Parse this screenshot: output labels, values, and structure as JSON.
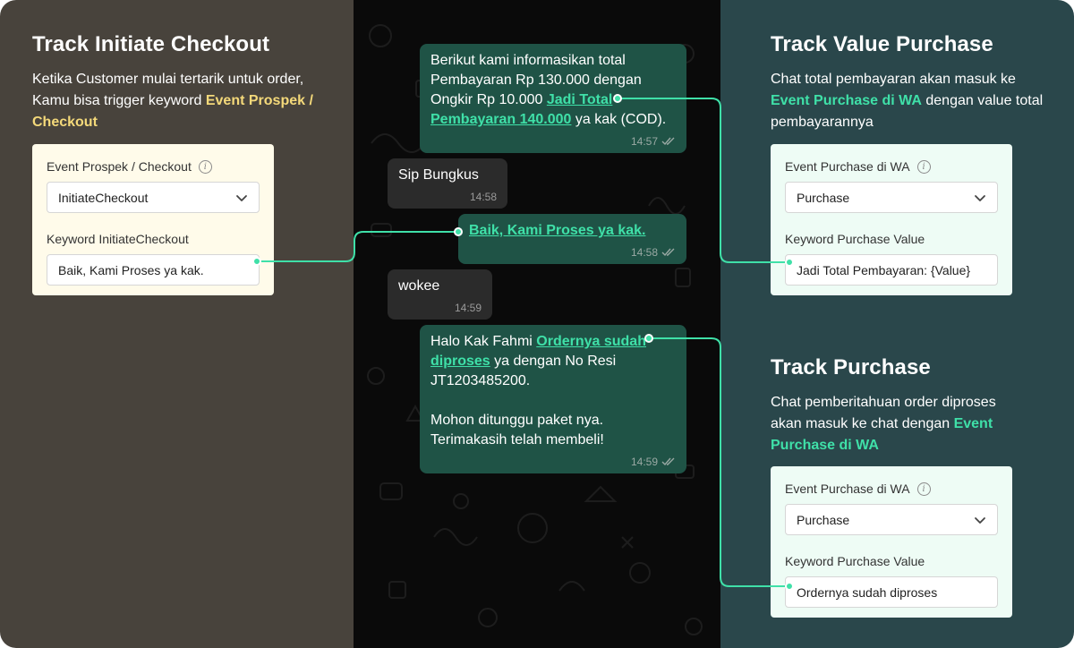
{
  "left": {
    "heading": "Track Initiate Checkout",
    "desc_1": "Ketika Customer mulai tertarik  untuk order, Kamu bisa trigger keyword ",
    "desc_hl": "Event Prospek / Checkout",
    "card": {
      "event_label": "Event Prospek / Checkout",
      "event_value": "InitiateCheckout",
      "keyword_label": "Keyword InitiateCheckout",
      "keyword_value": "Baik, Kami Proses ya kak."
    }
  },
  "chat": {
    "msg1": {
      "text_1": "Berikut kami informasikan total Pembayaran Rp 130.000 dengan Ongkir Rp 10.000 ",
      "link": "Jadi Total Pembayaran 140.000",
      "text_2": "  ya kak (COD).",
      "time": "14:57"
    },
    "msg2": {
      "text": "Sip Bungkus",
      "time": "14:58"
    },
    "msg3": {
      "link": "Baik, Kami Proses ya kak.",
      "time": "14:58"
    },
    "msg4": {
      "text": "wokee",
      "time": "14:59"
    },
    "msg5": {
      "text_1": "Halo Kak Fahmi ",
      "link": "Ordernya sudah diproses",
      "text_2": " ya dengan No Resi JT1203485200.",
      "text_3": "Mohon ditunggu paket nya. Terimakasih telah membeli!",
      "time": "14:59"
    }
  },
  "right_top": {
    "heading": "Track Value Purchase",
    "desc_1": "Chat total pembayaran akan masuk ke ",
    "desc_hl": "Event Purchase di WA",
    "desc_2": " dengan value total pembayarannya",
    "card": {
      "event_label": "Event Purchase di WA",
      "event_value": "Purchase",
      "keyword_label": "Keyword Purchase Value",
      "keyword_value": "Jadi Total Pembayaran: {Value}"
    }
  },
  "right_bottom": {
    "heading": "Track Purchase",
    "desc_1": "Chat pemberitahuan order diproses akan masuk ke chat dengan ",
    "desc_hl": "Event Purchase di WA",
    "card": {
      "event_label": "Event Purchase di WA",
      "event_value": "Purchase",
      "keyword_label": "Keyword Purchase Value",
      "keyword_value": "Ordernya sudah diproses"
    }
  },
  "icons": {
    "info": "info-icon",
    "chevron": "chevron-down-icon",
    "ticks": "double-check-icon"
  },
  "colors": {
    "left_bg": "#48433c",
    "chat_bg": "#0a0a0a",
    "right_bg": "#2a474b",
    "accent_green": "#3fe0a8",
    "accent_yellow": "#f4d97a",
    "bubble_out": "#1f5346",
    "bubble_in": "#2b2b2b"
  }
}
